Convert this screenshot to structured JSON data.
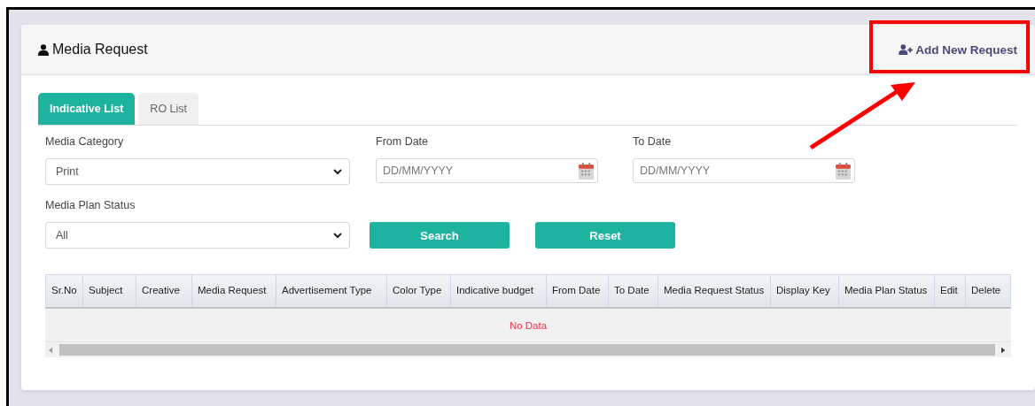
{
  "header": {
    "title": "Media Request",
    "add_link": "Add New Request"
  },
  "tabs": [
    {
      "label": "Indicative List",
      "selected": true
    },
    {
      "label": "RO List",
      "selected": false
    }
  ],
  "filters": [
    {
      "kind": "select",
      "label": "Media Category",
      "value": "Print"
    },
    {
      "kind": "date",
      "label": "From Date",
      "placeholder": "DD/MM/YYYY"
    },
    {
      "kind": "date",
      "label": "To Date",
      "placeholder": "DD/MM/YYYY"
    },
    {
      "kind": "select",
      "label": "Media Plan Status",
      "value": "All"
    }
  ],
  "buttons": [
    "Search",
    "Reset"
  ],
  "table": {
    "columns": [
      "Sr.No",
      "Subject",
      "Creative",
      "Media Request",
      "Advertisement Type",
      "Color Type",
      "Indicative budget",
      "From Date",
      "To Date",
      "Media Request Status",
      "Display Key",
      "Media Plan Status",
      "Edit",
      "Delete"
    ],
    "empty_message": "No Data"
  }
}
